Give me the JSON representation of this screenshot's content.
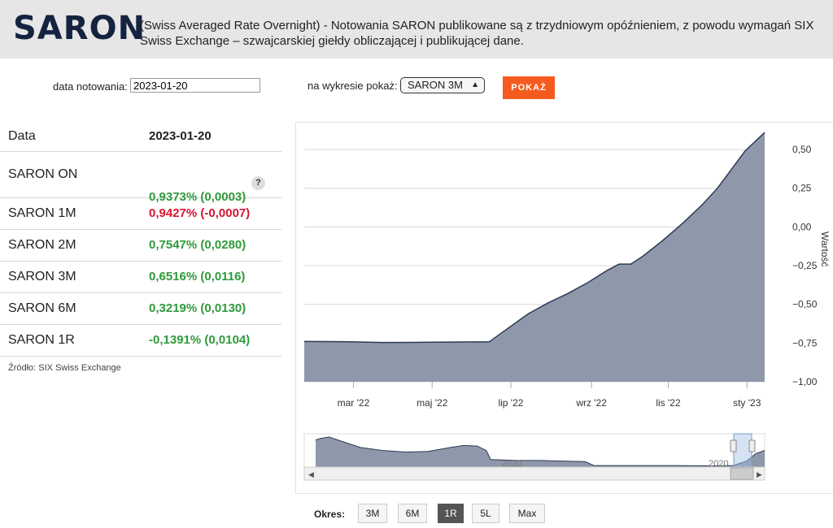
{
  "header": {
    "logo": "SARON",
    "description": "(Swiss Averaged Rate Overnight) - Notowania SARON publikowane są z trzydniowym opóźnieniem, z powodu wymagań SIX Swiss Exchange – szwajcarskiej giełdy obliczającej i publikującej dane."
  },
  "form": {
    "date_label": "data notowania:",
    "date_value": "2023-01-20",
    "chart_select_label": "na wykresie pokaż:",
    "chart_select_value": "SARON 3M",
    "submit_label": "POKAŻ"
  },
  "table": {
    "header_key": "Data",
    "header_value": "2023-01-20",
    "help_icon_label": "?",
    "rows": [
      {
        "name": "SARON ON",
        "value": "0,9373% (0,0003)",
        "trend": "up"
      },
      {
        "name": "SARON 1M",
        "value": "0,9427% (-0,0007)",
        "trend": "down"
      },
      {
        "name": "SARON 2M",
        "value": "0,7547% (0,0280)",
        "trend": "up"
      },
      {
        "name": "SARON 3M",
        "value": "0,6516% (0,0116)",
        "trend": "up"
      },
      {
        "name": "SARON 6M",
        "value": "0,3219% (0,0130)",
        "trend": "up"
      },
      {
        "name": "SARON 1R",
        "value": "-0,1391% (0,0104)",
        "trend": "up"
      }
    ],
    "source": "Źródło: SIX Swiss Exchange"
  },
  "chart_data": {
    "type": "area",
    "ylabel": "Wartość",
    "ylim": [
      -1.0,
      0.6
    ],
    "y_ticks": [
      "0,50",
      "0,25",
      "0,00",
      "−0,25",
      "−0,50",
      "−0,75",
      "−1,00"
    ],
    "y_tick_values": [
      0.5,
      0.25,
      0.0,
      -0.25,
      -0.5,
      -0.75,
      -1.0
    ],
    "x_ticks": [
      "mar '22",
      "maj '22",
      "lip '22",
      "wrz '22",
      "lis '22",
      "sty '23"
    ],
    "x_tick_values": [
      1.25,
      3.25,
      5.25,
      7.3,
      9.25,
      11.25
    ],
    "xlim": [
      0,
      11.7
    ],
    "series": [
      {
        "x": [
          0,
          1,
          2,
          3,
          4,
          4.7,
          5.2,
          5.7,
          6.2,
          6.7,
          7.2,
          7.7,
          8.0,
          8.3,
          8.6,
          9.1,
          9.6,
          10.1,
          10.5,
          10.85,
          11.2,
          11.7
        ],
        "y": [
          -0.74,
          -0.741,
          -0.746,
          -0.745,
          -0.743,
          -0.742,
          -0.65,
          -0.56,
          -0.49,
          -0.43,
          -0.36,
          -0.28,
          -0.24,
          -0.24,
          -0.19,
          -0.09,
          0.02,
          0.14,
          0.25,
          0.37,
          0.49,
          0.61
        ]
      }
    ],
    "color": "#8f98aa",
    "navigator": {
      "labels": [
        "2010",
        "2020"
      ],
      "label_positions": [
        0.45,
        0.9
      ]
    },
    "periods_label": "Okres:",
    "periods": [
      "3M",
      "6M",
      "1R",
      "5L",
      "Max"
    ],
    "active_period": "1R"
  }
}
